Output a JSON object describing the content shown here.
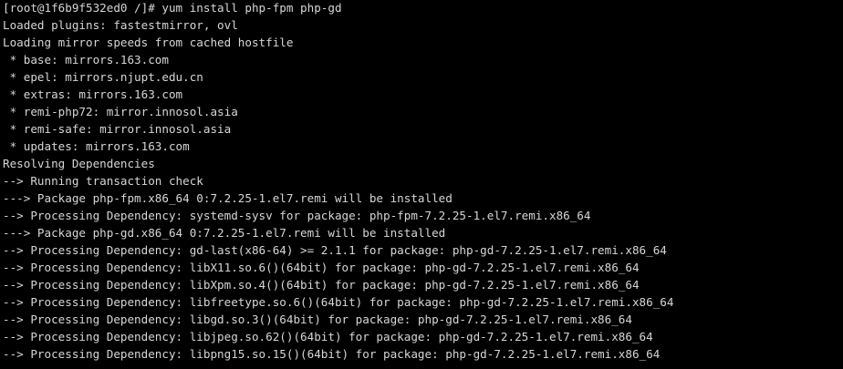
{
  "terminal": {
    "lines": [
      "[root@1f6b9f532ed0 /]# yum install php-fpm php-gd",
      "Loaded plugins: fastestmirror, ovl",
      "Loading mirror speeds from cached hostfile",
      " * base: mirrors.163.com",
      " * epel: mirrors.njupt.edu.cn",
      " * extras: mirrors.163.com",
      " * remi-php72: mirror.innosol.asia",
      " * remi-safe: mirror.innosol.asia",
      " * updates: mirrors.163.com",
      "Resolving Dependencies",
      "--> Running transaction check",
      "---> Package php-fpm.x86_64 0:7.2.25-1.el7.remi will be installed",
      "--> Processing Dependency: systemd-sysv for package: php-fpm-7.2.25-1.el7.remi.x86_64",
      "---> Package php-gd.x86_64 0:7.2.25-1.el7.remi will be installed",
      "--> Processing Dependency: gd-last(x86-64) >= 2.1.1 for package: php-gd-7.2.25-1.el7.remi.x86_64",
      "--> Processing Dependency: libX11.so.6()(64bit) for package: php-gd-7.2.25-1.el7.remi.x86_64",
      "--> Processing Dependency: libXpm.so.4()(64bit) for package: php-gd-7.2.25-1.el7.remi.x86_64",
      "--> Processing Dependency: libfreetype.so.6()(64bit) for package: php-gd-7.2.25-1.el7.remi.x86_64",
      "--> Processing Dependency: libgd.so.3()(64bit) for package: php-gd-7.2.25-1.el7.remi.x86_64",
      "--> Processing Dependency: libjpeg.so.62()(64bit) for package: php-gd-7.2.25-1.el7.remi.x86_64",
      "--> Processing Dependency: libpng15.so.15()(64bit) for package: php-gd-7.2.25-1.el7.remi.x86_64"
    ]
  },
  "colors": {
    "background": "#000000",
    "text": "#d6d6d6"
  }
}
